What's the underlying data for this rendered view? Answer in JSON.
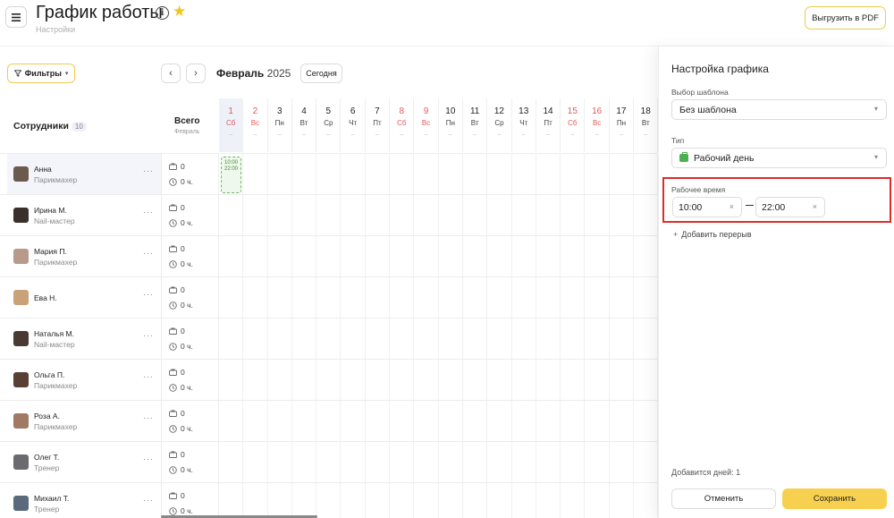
{
  "header": {
    "title": "График работы",
    "subtitle": "Настройки",
    "pdf_label": "Выгрузить в PDF"
  },
  "toolbar": {
    "filter_label": "Фильтры",
    "month_name": "Февраль",
    "year": "2025",
    "today_label": "Сегодня"
  },
  "table": {
    "employees_title": "Сотрудники",
    "employees_count": "10",
    "total_title": "Всего",
    "total_sub": "Февраль",
    "days": [
      {
        "num": "1",
        "wd": "Сб",
        "weekend": true,
        "selected": true
      },
      {
        "num": "2",
        "wd": "Вс",
        "weekend": true
      },
      {
        "num": "3",
        "wd": "Пн"
      },
      {
        "num": "4",
        "wd": "Вт"
      },
      {
        "num": "5",
        "wd": "Ср"
      },
      {
        "num": "6",
        "wd": "Чт"
      },
      {
        "num": "7",
        "wd": "Пт"
      },
      {
        "num": "8",
        "wd": "Сб",
        "weekend": true
      },
      {
        "num": "9",
        "wd": "Вс",
        "weekend": true
      },
      {
        "num": "10",
        "wd": "Пн"
      },
      {
        "num": "11",
        "wd": "Вт"
      },
      {
        "num": "12",
        "wd": "Ср"
      },
      {
        "num": "13",
        "wd": "Чт"
      },
      {
        "num": "14",
        "wd": "Пт"
      },
      {
        "num": "15",
        "wd": "Сб",
        "weekend": true
      },
      {
        "num": "16",
        "wd": "Вс",
        "weekend": true
      },
      {
        "num": "17",
        "wd": "Пн"
      },
      {
        "num": "18",
        "wd": "Вт"
      }
    ],
    "day_dash": "–",
    "employees": [
      {
        "name": "Анна",
        "role": "Парикмахер",
        "shifts": "0",
        "hours": "0 ч.",
        "avatar_color": "#6b5a4e",
        "selected": true
      },
      {
        "name": "Ирина М.",
        "role": "Nail-мастер",
        "shifts": "0",
        "hours": "0 ч.",
        "avatar_color": "#3a2f2a"
      },
      {
        "name": "Мария П.",
        "role": "Парикмахер",
        "shifts": "0",
        "hours": "0 ч.",
        "avatar_color": "#b89a8a"
      },
      {
        "name": "Ева Н.",
        "role": "",
        "shifts": "0",
        "hours": "0 ч.",
        "avatar_color": "#c9a27a"
      },
      {
        "name": "Наталья М.",
        "role": "Nail-мастер",
        "shifts": "0",
        "hours": "0 ч.",
        "avatar_color": "#4a3a34"
      },
      {
        "name": "Ольга П.",
        "role": "Парикмахер",
        "shifts": "0",
        "hours": "0 ч.",
        "avatar_color": "#5a3f34"
      },
      {
        "name": "Роза А.",
        "role": "Парикмахер",
        "shifts": "0",
        "hours": "0 ч.",
        "avatar_color": "#a07a62"
      },
      {
        "name": "Олег Т.",
        "role": "Тренер",
        "shifts": "0",
        "hours": "0 ч.",
        "avatar_color": "#6a6a70"
      },
      {
        "name": "Михаил Т.",
        "role": "Тренер",
        "shifts": "0",
        "hours": "0 ч.",
        "avatar_color": "#5a6a7a"
      }
    ],
    "shift_start": "10:00",
    "shift_end": "22:00"
  },
  "panel": {
    "title": "Настройка графика",
    "template_label": "Выбор шаблона",
    "template_value": "Без шаблона",
    "type_label": "Тип",
    "type_value": "Рабочий день",
    "worktime_label": "Рабочее время",
    "time_from": "10:00",
    "time_to": "22:00",
    "add_break_label": "Добавить перерыв",
    "days_added": "Добавится дней: 1",
    "cancel_label": "Отменить",
    "save_label": "Сохранить"
  },
  "colors": {
    "accent": "#f7d050",
    "weekend": "#e05a5a",
    "highlight": "#e02b2b",
    "shift_green": "#6dbb63"
  }
}
